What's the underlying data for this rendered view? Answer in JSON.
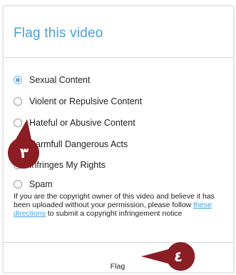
{
  "dialog": {
    "title": "Flag this video",
    "options": [
      {
        "label": "Sexual Content",
        "selected": true
      },
      {
        "label": "Violent or Repulsive Content",
        "selected": false
      },
      {
        "label": "Hateful or Abusive Content",
        "selected": false
      },
      {
        "label": "Harmfull Dangerous Acts",
        "selected": false
      },
      {
        "label": "Infringes My Rights",
        "selected": false
      },
      {
        "label": "Spam",
        "selected": false
      }
    ],
    "notice": {
      "before": "If you are the copyright owner of this video and believe it has been uploaded without your permission, please follow ",
      "link": "these directions",
      "after": " to submit a copyright infringement notice"
    },
    "flag_label": "Flag"
  },
  "annotations": {
    "marker_options": "٣",
    "marker_flag": "٤"
  },
  "colors": {
    "accent": "#4a9fd8",
    "marker": "#8b1e25"
  }
}
